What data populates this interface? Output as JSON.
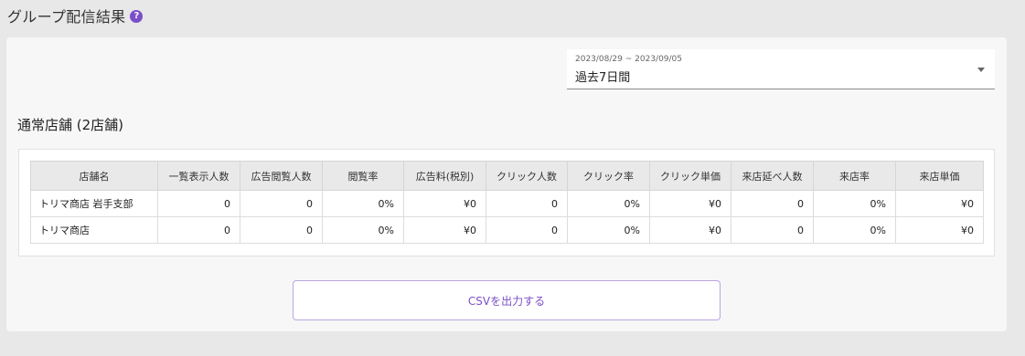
{
  "page": {
    "title": "グループ配信結果",
    "help_icon": "?"
  },
  "date_filter": {
    "range": "2023/08/29 ~ 2023/09/05",
    "value": "過去7日間"
  },
  "section": {
    "title": "通常店舗 (2店舗)"
  },
  "table": {
    "headers": [
      "店舗名",
      "一覧表示人数",
      "広告閲覧人数",
      "閲覧率",
      "広告料(税別)",
      "クリック人数",
      "クリック率",
      "クリック単価",
      "来店延べ人数",
      "来店率",
      "来店単価"
    ],
    "rows": [
      [
        "トリマ商店 岩手支部",
        "0",
        "0",
        "0%",
        "¥0",
        "0",
        "0%",
        "¥0",
        "0",
        "0%",
        "¥0"
      ],
      [
        "トリマ商店",
        "0",
        "0",
        "0%",
        "¥0",
        "0",
        "0%",
        "¥0",
        "0",
        "0%",
        "¥0"
      ]
    ]
  },
  "csv_button": {
    "label": "CSVを出力する"
  },
  "colors": {
    "accent": "#7b4fc9",
    "background": "#e8e8e8",
    "card": "#f7f7f7"
  }
}
